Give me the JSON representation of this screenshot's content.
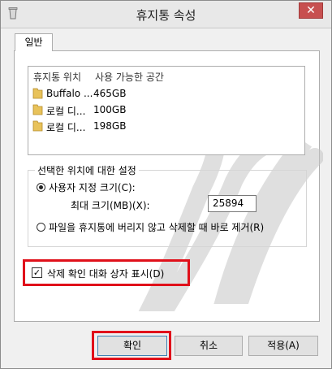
{
  "window": {
    "title": "휴지통 속성",
    "close_label": "✕"
  },
  "tabs": [
    {
      "label": "일반"
    }
  ],
  "list": {
    "headers": [
      "휴지통 위치",
      "사용 가능한 공간"
    ],
    "rows": [
      {
        "name": "Buffalo ...",
        "space": "465GB"
      },
      {
        "name": "로컬 디...",
        "space": "100GB"
      },
      {
        "name": "로컬 디...",
        "space": "198GB"
      }
    ]
  },
  "settings": {
    "legend": "선택한 위치에 대한 설정",
    "custom_size_label": "사용자 지정 크기(C):",
    "max_size_label": "최대 크기(MB)(X):",
    "max_size_value": "25894",
    "no_recycle_label": "파일을 휴지통에 버리지 않고 삭제할 때 바로 제거(R)"
  },
  "confirm_checkbox": {
    "label": "삭제 확인 대화 상자 표시(D)",
    "checked": true
  },
  "buttons": {
    "ok": "확인",
    "cancel": "취소",
    "apply": "적용(A)"
  },
  "colors": {
    "highlight": "#e0101a",
    "folder": "#e8c25a"
  }
}
